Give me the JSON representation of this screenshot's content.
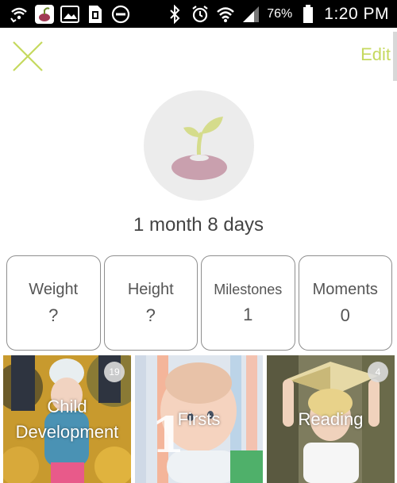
{
  "status_bar": {
    "battery": "76%",
    "time": "1:20 PM"
  },
  "header": {
    "edit_label": "Edit"
  },
  "profile": {
    "age": "1 month 8 days"
  },
  "stats": [
    {
      "label": "Weight",
      "value": "?"
    },
    {
      "label": "Height",
      "value": "?"
    },
    {
      "label": "Milestones",
      "value": "1"
    },
    {
      "label": "Moments",
      "value": "0"
    }
  ],
  "tiles": [
    {
      "label_line1": "Child",
      "label_line2": "Development",
      "badge": "19"
    },
    {
      "label": "Firsts",
      "numeral": "1"
    },
    {
      "label": "Reading",
      "badge": "4"
    }
  ],
  "colors": {
    "accent": "#c5d95e",
    "avatar_bg": "#ececec",
    "leaf": "#d5dc8c",
    "bean": "#c9a0ae"
  }
}
